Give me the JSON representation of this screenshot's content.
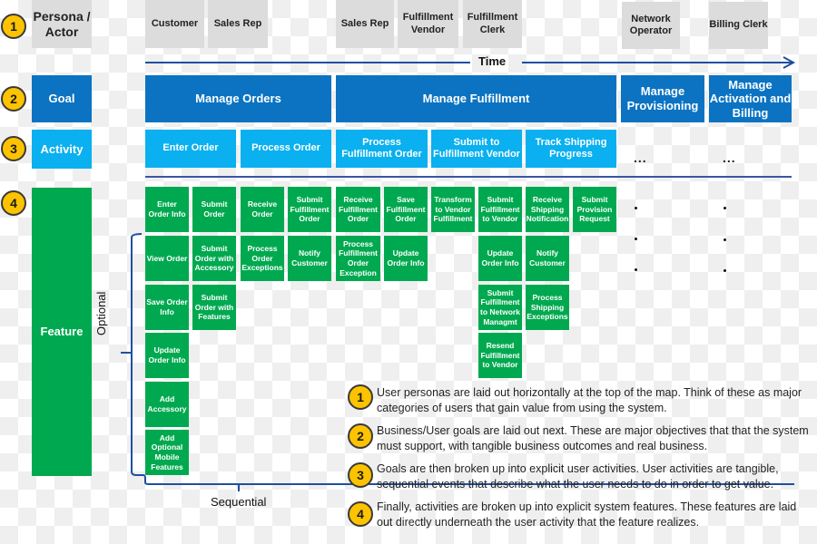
{
  "row_labels": {
    "persona": "Persona / Actor",
    "goal": "Goal",
    "activity": "Activity",
    "feature": "Feature"
  },
  "row_badges": [
    "1",
    "2",
    "3",
    "4"
  ],
  "personas": [
    "Customer",
    "Sales Rep",
    "Sales Rep",
    "Fulfillment Vendor",
    "Fulfillment Clerk",
    "Network Operator",
    "Billing Clerk"
  ],
  "time_label": "Time",
  "goals": [
    "Manage Orders",
    "Manage Fulfillment",
    "Manage Provisioning",
    "Manage Activation and Billing"
  ],
  "activities": [
    "Enter Order",
    "Process Order",
    "Process Fulfillment Order",
    "Submit to Fulfillment Vendor",
    "Track Shipping Progress",
    "...",
    "..."
  ],
  "features": {
    "col1": [
      "Enter Order Info",
      "View Order",
      "Save Order Info",
      "Update Order Info",
      "Add Accessory",
      "Add Optional Mobile Features"
    ],
    "col2": [
      "Submit Order",
      "Submit Order with Accessory",
      "Submit Order with Features"
    ],
    "col3": [
      "Receive Order",
      "Process Order Exceptions"
    ],
    "col4": [
      "Submit Fulfillment Order",
      "Notify Customer"
    ],
    "col5": [
      "Receive Fulfillment Order",
      "Process Fulfillment Order Exception"
    ],
    "col6": [
      "Save Fulfillment Order",
      "Update Order Info"
    ],
    "col7": [
      "Transform to Vendor Fulfillment"
    ],
    "col8": [
      "Submit Fulfillment to Vendor",
      "Update Order Info",
      "Submit Fulfillment to Network Managmt",
      "Resend Fulfillment to Vendor"
    ],
    "col9": [
      "Receive Shipping Notification",
      "Notify Customer",
      "Process Shipping Exceptions"
    ],
    "col10": [
      "Submit Provision Request"
    ]
  },
  "axis_labels": {
    "optional": "Optional",
    "sequential": "Sequential"
  },
  "notes": [
    {
      "badge": "1",
      "text": "User personas are laid out horizontally at the top of the map. Think of these as major categories of users that gain value from using the system."
    },
    {
      "badge": "2",
      "text": "Business/User goals are laid out next. These are major objectives that that the system must support, with tangible business outcomes and real business."
    },
    {
      "badge": "3",
      "text": "Goals are then broken up into explicit user activities. User activities are tangible, sequential events that describe what the user needs to do in order to get value."
    },
    {
      "badge": "4",
      "text": "Finally, activities are broken up into explicit system features. These features are laid out directly underneath the user activity that the feature realizes."
    }
  ],
  "colors": {
    "goal": "#0b73c2",
    "activity": "#0ab0ef",
    "feature": "#00a94f",
    "persona": "#dcdcdc",
    "badge": "#fdc300",
    "line": "#1f4fa3"
  }
}
